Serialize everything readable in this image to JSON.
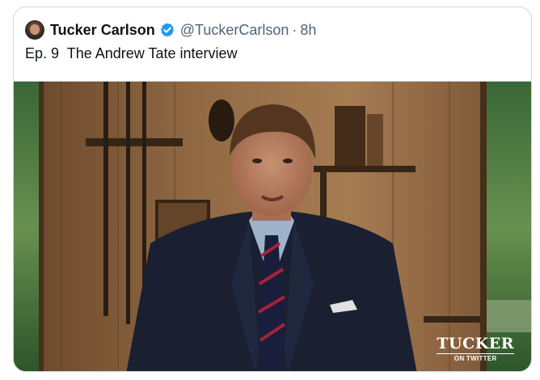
{
  "tweet": {
    "author_name": "Tucker Carlson",
    "handle": "@TuckerCarlson",
    "separator": "·",
    "time": "8h",
    "text": "Ep. 9  The Andrew Tate interview",
    "verified_icon": "verified-badge-icon",
    "colors": {
      "verified": "#1d9bf0",
      "name": "#0f1419",
      "secondary": "#536471",
      "border": "#cfd9de"
    }
  },
  "media": {
    "watermark_main": "TUCKER",
    "watermark_sub": "ON TWITTER"
  }
}
